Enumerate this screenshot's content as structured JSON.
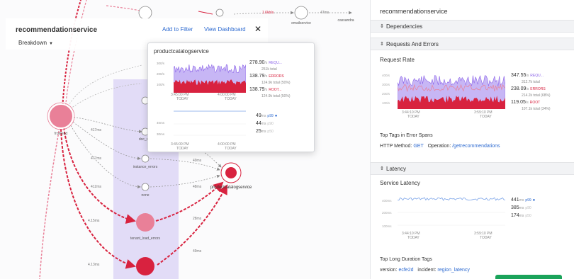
{
  "map": {
    "nodes": [
      {
        "label": "frontend"
      },
      {
        "label": "checkout_svc"
      },
      {
        "label": "doc_svc"
      },
      {
        "label": "instance_errors"
      },
      {
        "label": "none"
      },
      {
        "label": "productcatalogservice"
      },
      {
        "label": "tenant_load_errors"
      },
      {
        "label": "emailservice"
      },
      {
        "label": "cassandra"
      }
    ],
    "edge_labels": [
      "417ms",
      "2.1ms",
      "477ms",
      "412ms",
      "4.15ms",
      "4.13ms",
      "49ms",
      "48ms",
      "28ms",
      "49ms",
      "1.6kb/s",
      "47ms"
    ],
    "colors": {
      "error": "#d8223f",
      "error_light": "#e98098",
      "highlight": "#ddd6f6"
    }
  },
  "info_panel": {
    "title": "recommendationservice",
    "breakdown_label": "Breakdown",
    "add_to_filter": "Add to Filter",
    "view_dashboard": "View Dashboard",
    "close_glyph": "✕"
  },
  "popup": {
    "title": "productcatalogservice",
    "rate_ticks": [
      "300/s",
      "200/s",
      "100/s"
    ],
    "rate_times": [
      {
        "t": "3:45:00 PM",
        "d": "TODAY"
      },
      {
        "t": "4:00:00 PM",
        "d": "TODAY"
      }
    ],
    "stats": [
      {
        "value": "278.90",
        "unit": "/s",
        "label": "REQU...",
        "sub": "251k total",
        "color": "#8b63e8"
      },
      {
        "value": "138.79",
        "unit": "/s",
        "label": "ERRORS",
        "sub": "124.9k total (50%)",
        "color": "#d8223f"
      },
      {
        "value": "138.79",
        "unit": "/s",
        "label": "ROOT...",
        "sub": "124.9k total (50%)",
        "color": "#d8223f"
      }
    ],
    "latency_ticks": [
      "40ms",
      "30ms"
    ],
    "latency_times": [
      {
        "t": "3:45:00 PM",
        "d": "TODAY"
      },
      {
        "t": "4:00:00 PM",
        "d": "TODAY"
      }
    ],
    "latency": [
      {
        "value": "49",
        "unit": "ms",
        "label": "p99"
      },
      {
        "value": "44",
        "unit": "ms",
        "label": "p90"
      },
      {
        "value": "25",
        "unit": "ms",
        "label": "p50"
      }
    ]
  },
  "side_panel": {
    "title": "recommendationservice",
    "sections": {
      "dependencies": "Dependencies",
      "requests": "Requests And Errors",
      "latency": "Latency"
    },
    "request_rate_label": "Request Rate",
    "rate_ticks": [
      "400/s",
      "300/s",
      "200/s",
      "100/s"
    ],
    "rate_times": [
      {
        "t": "3:44:10 PM",
        "d": "TODAY"
      },
      {
        "t": "3:59:10 PM",
        "d": "TODAY"
      }
    ],
    "stats": [
      {
        "value": "347.55",
        "unit": "/s",
        "label": "REQU...",
        "sub": "312.7k total",
        "color": "#8b63e8"
      },
      {
        "value": "238.09",
        "unit": "/s",
        "label": "ERRORS",
        "sub": "214.2k total (68%)",
        "color": "#d8223f"
      },
      {
        "value": "119.05",
        "unit": "/s",
        "label": "ROOT",
        "sub": "107.1k total (34%)",
        "color": "#d8223f"
      }
    ],
    "top_tags_error_label": "Top Tags in Error Spans",
    "error_tag": {
      "key": "HTTP Method:",
      "value": "GET",
      "key2": "Operation:",
      "value2": "/getrecommendations"
    },
    "service_latency_label": "Service Latency",
    "latency_ticks": [
      "400ms",
      "200ms",
      "100ms"
    ],
    "latency_times": [
      {
        "t": "3:44:10 PM",
        "d": "TODAY"
      },
      {
        "t": "3:59:10 PM",
        "d": "TODAY"
      }
    ],
    "latency": [
      {
        "value": "441",
        "unit": "ms",
        "label": "p99"
      },
      {
        "value": "385",
        "unit": "ms",
        "label": "p90"
      },
      {
        "value": "174",
        "unit": "ms",
        "label": "p50"
      }
    ],
    "top_long_label": "Top Long Duration Tags",
    "long_tag": {
      "key": "version:",
      "value": "ecfe2d",
      "key2": "incident:",
      "value2": "region_latency"
    }
  }
}
